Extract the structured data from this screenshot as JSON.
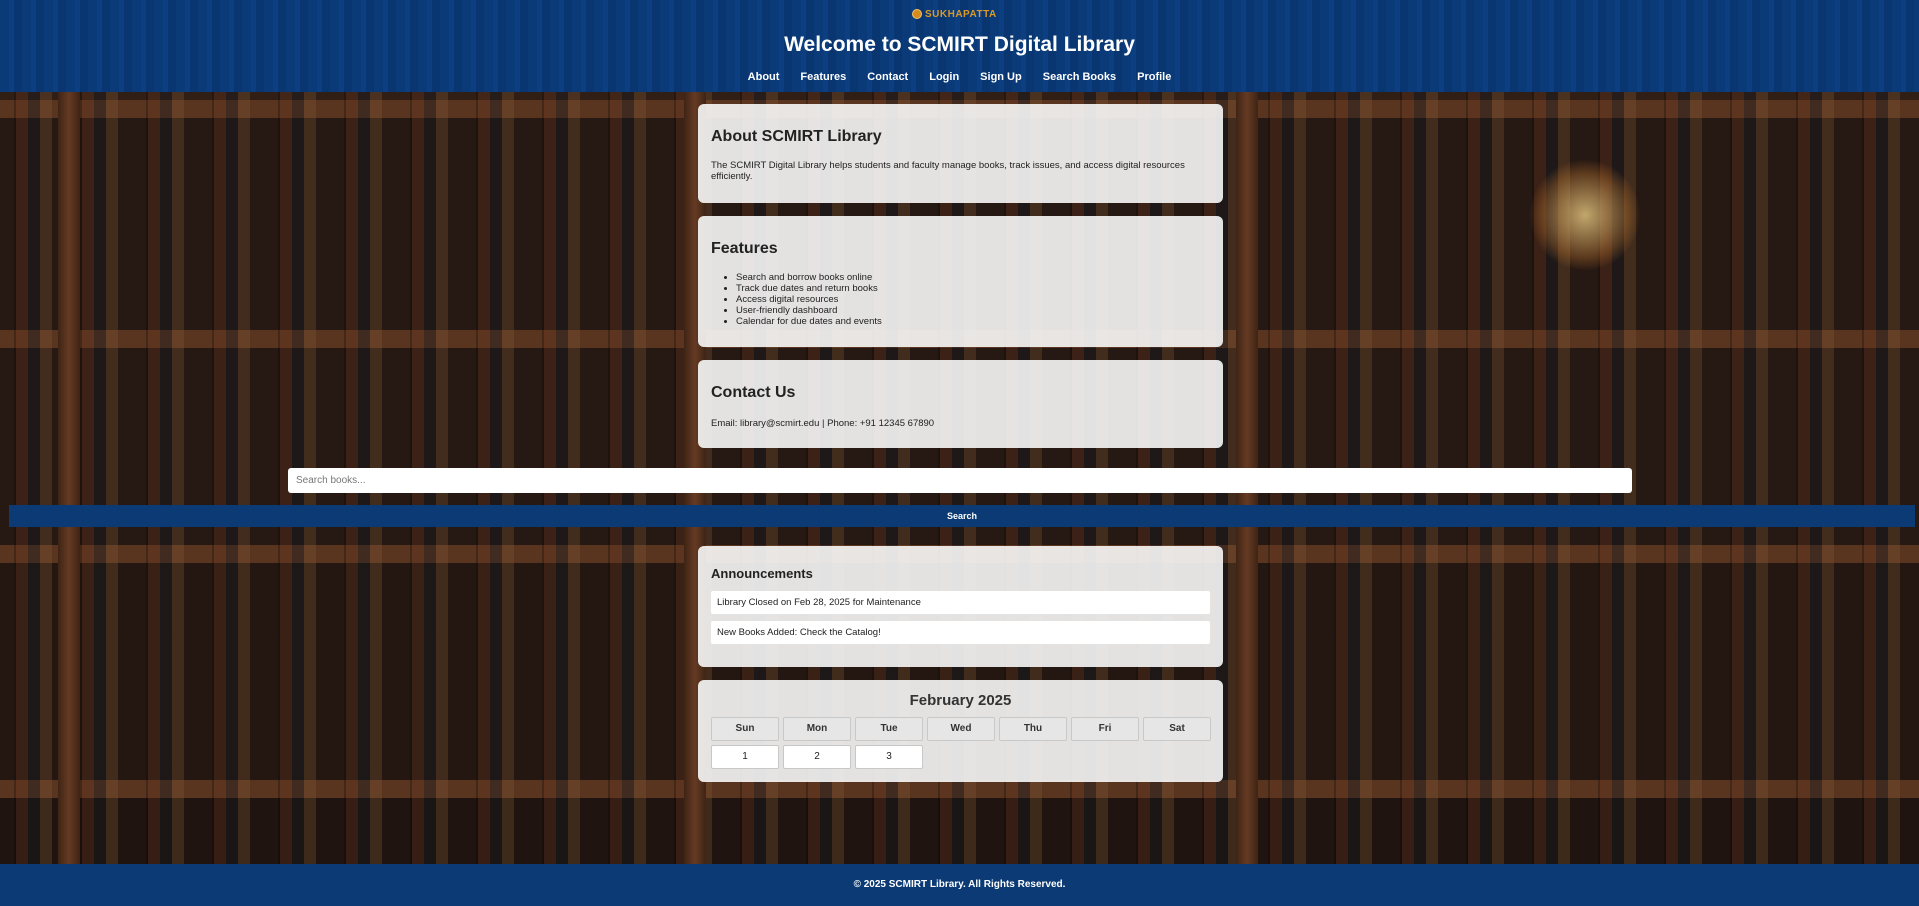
{
  "header": {
    "logo_text": "SUKHAPATTA",
    "title": "Welcome to SCMIRT Digital Library",
    "nav": [
      "About",
      "Features",
      "Contact",
      "Login",
      "Sign Up",
      "Search Books",
      "Profile"
    ]
  },
  "about": {
    "title": "About SCMIRT Library",
    "text": "The SCMIRT Digital Library helps students and faculty manage books, track issues, and access digital resources efficiently."
  },
  "features": {
    "title": "Features",
    "items": [
      "Search and borrow books online",
      "Track due dates and return books",
      "Access digital resources",
      "User-friendly dashboard",
      "Calendar for due dates and events"
    ]
  },
  "contact": {
    "title": "Contact Us",
    "text": "Email: library@scmirt.edu | Phone: +91 12345 67890"
  },
  "search": {
    "placeholder": "Search books...",
    "button_label": "Search"
  },
  "announcements": {
    "title": "Announcements",
    "items": [
      "Library Closed on Feb 28, 2025 for Maintenance",
      "New Books Added: Check the Catalog!"
    ]
  },
  "calendar": {
    "title": "February 2025",
    "weekdays": [
      "Sun",
      "Mon",
      "Tue",
      "Wed",
      "Thu",
      "Fri",
      "Sat"
    ],
    "days": [
      "1",
      "2",
      "3"
    ]
  },
  "footer": {
    "text": "© 2025 SCMIRT Library. All Rights Reserved."
  },
  "colors": {
    "header_blue": "#0a3a78",
    "footer_blue": "#0b3a74",
    "card_bg": "#f8f8f8"
  }
}
